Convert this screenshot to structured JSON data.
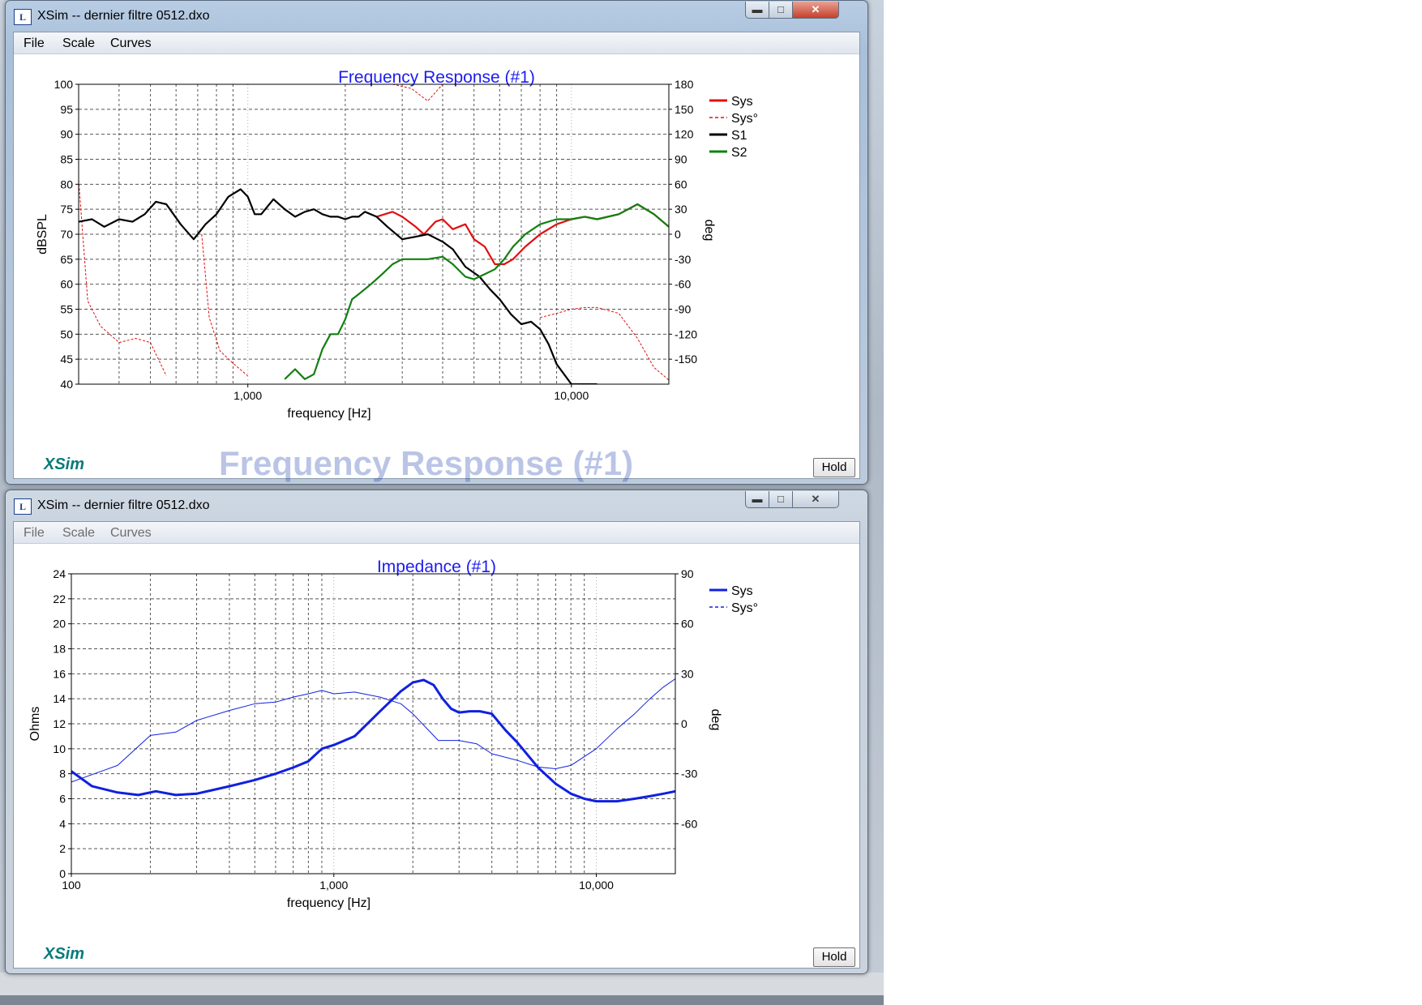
{
  "window_title": "XSim -- dernier filtre 0512.dxo",
  "menu": [
    "File",
    "Scale",
    "Curves"
  ],
  "logo_text": "XSim",
  "hold_label": "Hold",
  "colors": {
    "title_blue": "#1c1cf0",
    "sys_red": "#e01010",
    "s1_black": "#000000",
    "s2_green": "#108010",
    "imp_blue": "#1020e0"
  },
  "charts": [
    {
      "title": "Frequency Response (#1)",
      "ylabel": "dBSPL",
      "y2label": "deg",
      "xlabel": "frequency [Hz]",
      "x_ticks": [
        "1,000",
        "10,000"
      ],
      "y_ticks": [
        "100",
        "95",
        "90",
        "85",
        "80",
        "75",
        "70",
        "65",
        "60",
        "55",
        "50",
        "45",
        "40"
      ],
      "y2_ticks": [
        "180",
        "150",
        "120",
        "90",
        "60",
        "30",
        "0",
        "-30",
        "-60",
        "-90",
        "-120",
        "-150"
      ],
      "legend": [
        "Sys",
        "Sys°",
        "S1",
        "S2"
      ]
    },
    {
      "title": "Impedance (#1)",
      "ylabel": "Ohms",
      "y2label": "deg",
      "xlabel": "frequency [Hz]",
      "x_ticks": [
        "100",
        "1,000",
        "10,000"
      ],
      "y_ticks": [
        "24",
        "22",
        "20",
        "18",
        "16",
        "14",
        "12",
        "10",
        "8",
        "6",
        "4",
        "2",
        "0"
      ],
      "y2_ticks": [
        "90",
        "60",
        "30",
        "0",
        "-30",
        "-60"
      ],
      "legend": [
        "Sys",
        "Sys°"
      ]
    }
  ],
  "chart_data": [
    {
      "type": "line",
      "title": "Frequency Response (#1)",
      "xlabel": "frequency [Hz]",
      "ylabel": "dBSPL",
      "y2label": "deg",
      "xlim": [
        300,
        20000
      ],
      "xscale": "log",
      "ylim": [
        40,
        100
      ],
      "y2lim": [
        -180,
        180
      ],
      "grid": true,
      "legend_position": "right",
      "series": [
        {
          "name": "Sys",
          "color": "#e01010",
          "style": "solid",
          "axis": "y",
          "x": [
            2500,
            2800,
            3000,
            3300,
            3500,
            3800,
            4000,
            4300,
            4700,
            5000,
            5400,
            5800,
            6200,
            6600,
            7200,
            8000,
            9000,
            10000,
            11000,
            12000,
            14000,
            16000,
            18000,
            20000
          ],
          "y": [
            73.5,
            74.5,
            73.5,
            71.5,
            70,
            72.5,
            73,
            71,
            72,
            69,
            67.5,
            64,
            64,
            65,
            67.5,
            70,
            72,
            73,
            73.5,
            73,
            74,
            76,
            74,
            71.5
          ]
        },
        {
          "name": "Sys°",
          "color": "#e01010",
          "style": "dashed",
          "axis": "y2",
          "x": [
            300,
            320,
            350,
            400,
            450,
            500,
            560
          ],
          "y": [
            65,
            -80,
            -110,
            -130,
            -125,
            -130,
            -170
          ]
        },
        {
          "name": "Sys°",
          "color": "#e01010",
          "style": "dashed",
          "axis": "y2",
          "x": [
            720,
            760,
            820,
            900,
            1000
          ],
          "y": [
            0,
            -100,
            -140,
            -155,
            -170
          ]
        },
        {
          "name": "Sys°",
          "color": "#e01010",
          "style": "dashed",
          "axis": "y2",
          "x": [
            2800,
            3200,
            3600,
            4000
          ],
          "y": [
            180,
            175,
            160,
            180
          ]
        },
        {
          "name": "Sys°",
          "color": "#e01010",
          "style": "dashed",
          "axis": "y2",
          "x": [
            8000,
            9000,
            10000,
            11000,
            12000,
            14000,
            16000,
            18000,
            20000
          ],
          "y": [
            -100,
            -95,
            -90,
            -88,
            -88,
            -95,
            -125,
            -160,
            -175
          ]
        },
        {
          "name": "S1",
          "color": "#000000",
          "style": "solid",
          "axis": "y",
          "x": [
            300,
            330,
            360,
            400,
            440,
            480,
            520,
            560,
            620,
            680,
            740,
            800,
            870,
            950,
            1000,
            1050,
            1100,
            1200,
            1300,
            1400,
            1500,
            1600,
            1700,
            1800,
            1900,
            2000,
            2100,
            2200,
            2300,
            2500,
            2700,
            3000,
            3300,
            3600,
            4000,
            4300,
            4700,
            5200,
            5600,
            6000,
            6500,
            7000,
            7500,
            8000,
            8500,
            9000,
            10000,
            10500,
            11000,
            11500,
            12000
          ],
          "y": [
            72.5,
            73,
            71.5,
            73,
            72.5,
            74,
            76.5,
            76,
            72,
            69,
            72,
            74,
            77.5,
            79,
            77.5,
            74,
            74,
            77,
            75,
            73.5,
            74.5,
            75,
            74,
            73.5,
            73.5,
            73,
            73.5,
            73.5,
            74.5,
            73.5,
            71.5,
            69,
            69.5,
            70,
            68.5,
            67,
            63.5,
            61.5,
            59,
            57,
            54,
            52,
            52.5,
            51,
            48,
            44,
            40,
            40,
            40,
            40,
            40
          ]
        },
        {
          "name": "S2",
          "color": "#108010",
          "style": "solid",
          "axis": "y",
          "x": [
            1300,
            1400,
            1500,
            1600,
            1700,
            1800,
            1900,
            2000,
            2100,
            2200,
            2400,
            2600,
            2800,
            3000,
            3300,
            3600,
            4000,
            4300,
            4700,
            5000,
            5400,
            5800,
            6200,
            6600,
            7200,
            8000,
            9000,
            10000,
            11000,
            12000,
            14000,
            16000,
            18000,
            20000
          ],
          "y": [
            41,
            43,
            41,
            42,
            47,
            50,
            50,
            53,
            57,
            58,
            60,
            62,
            64,
            65,
            65,
            65,
            65.5,
            64,
            61.5,
            61,
            62,
            63,
            65,
            67.5,
            70,
            72,
            73,
            73,
            73.5,
            73,
            74,
            76,
            74,
            71.5
          ]
        }
      ]
    },
    {
      "type": "line",
      "title": "Impedance (#1)",
      "xlabel": "frequency [Hz]",
      "ylabel": "Ohms",
      "y2label": "deg",
      "xlim": [
        100,
        20000
      ],
      "xscale": "log",
      "ylim": [
        0,
        24
      ],
      "y2lim": [
        -90,
        90
      ],
      "grid": true,
      "legend_position": "right",
      "series": [
        {
          "name": "Sys",
          "color": "#1020e0",
          "style": "solid-thick",
          "axis": "y",
          "x": [
            100,
            120,
            150,
            180,
            210,
            250,
            300,
            400,
            500,
            600,
            700,
            800,
            900,
            1000,
            1200,
            1500,
            1800,
            2000,
            2200,
            2400,
            2600,
            2800,
            3000,
            3300,
            3600,
            4000,
            4500,
            5000,
            6000,
            7000,
            8000,
            9000,
            10000,
            12000,
            14000,
            16000,
            18000,
            20000
          ],
          "y": [
            8.2,
            7,
            6.5,
            6.3,
            6.6,
            6.3,
            6.4,
            7,
            7.5,
            8,
            8.5,
            9,
            10,
            10.3,
            11,
            13,
            14.6,
            15.3,
            15.5,
            15.1,
            14,
            13.2,
            12.9,
            13,
            13,
            12.8,
            11.5,
            10.5,
            8.5,
            7.2,
            6.4,
            6,
            5.8,
            5.8,
            6,
            6.2,
            6.4,
            6.6
          ]
        },
        {
          "name": "Sys°",
          "color": "#1020e0",
          "style": "solid-thin",
          "axis": "y2",
          "x": [
            100,
            150,
            200,
            250,
            300,
            400,
            500,
            600,
            700,
            800,
            900,
            1000,
            1200,
            1500,
            1800,
            2000,
            2500,
            3000,
            3500,
            4000,
            5000,
            6000,
            7000,
            8000,
            10000,
            12000,
            14000,
            16000,
            18000,
            20000
          ],
          "y": [
            -35,
            -25,
            -7,
            -5,
            2,
            8,
            12,
            13,
            16,
            18,
            20,
            18,
            19,
            16,
            12,
            6,
            -10,
            -10,
            -12,
            -18,
            -22,
            -26,
            -27,
            -25,
            -15,
            -3,
            6,
            15,
            22,
            27
          ]
        }
      ]
    }
  ]
}
